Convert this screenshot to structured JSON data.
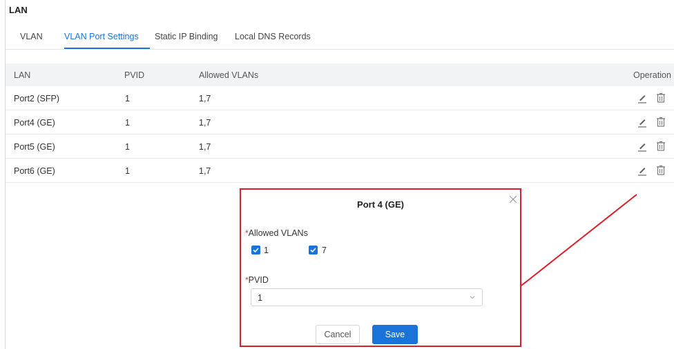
{
  "page": {
    "title": "LAN"
  },
  "tabs": [
    {
      "label": "VLAN",
      "active": false
    },
    {
      "label": "VLAN Port Settings",
      "active": true
    },
    {
      "label": "Static IP Binding",
      "active": false
    },
    {
      "label": "Local DNS Records",
      "active": false
    }
  ],
  "table": {
    "headers": [
      "LAN",
      "PVID",
      "Allowed VLANs",
      "Operation"
    ],
    "rows": [
      {
        "lan": "Port2 (SFP)",
        "pvid": "1",
        "allowed": "1,7",
        "actions": [
          "edit-icon",
          "delete-icon"
        ]
      },
      {
        "lan": "Port4 (GE)",
        "pvid": "1",
        "allowed": "1,7",
        "actions": [
          "edit-icon",
          "delete-icon"
        ]
      },
      {
        "lan": "Port5 (GE)",
        "pvid": "1",
        "allowed": "1,7",
        "actions": [
          "edit-icon",
          "delete-icon"
        ]
      },
      {
        "lan": "Port6 (GE)",
        "pvid": "1",
        "allowed": "1,7",
        "actions": [
          "edit-icon",
          "delete-icon"
        ]
      }
    ]
  },
  "dialog": {
    "title": "Port 4 (GE)",
    "allowed_label": "Allowed VLANs",
    "required_mark": "*",
    "checkboxes": [
      {
        "label": "1",
        "checked": true
      },
      {
        "label": "7",
        "checked": true
      }
    ],
    "pvid_label": "PVID",
    "pvid_value": "1",
    "cancel_label": "Cancel",
    "save_label": "Save"
  },
  "colors": {
    "accent": "#1a73d9",
    "highlight_border": "#d9202a",
    "required": "#e5322d"
  }
}
